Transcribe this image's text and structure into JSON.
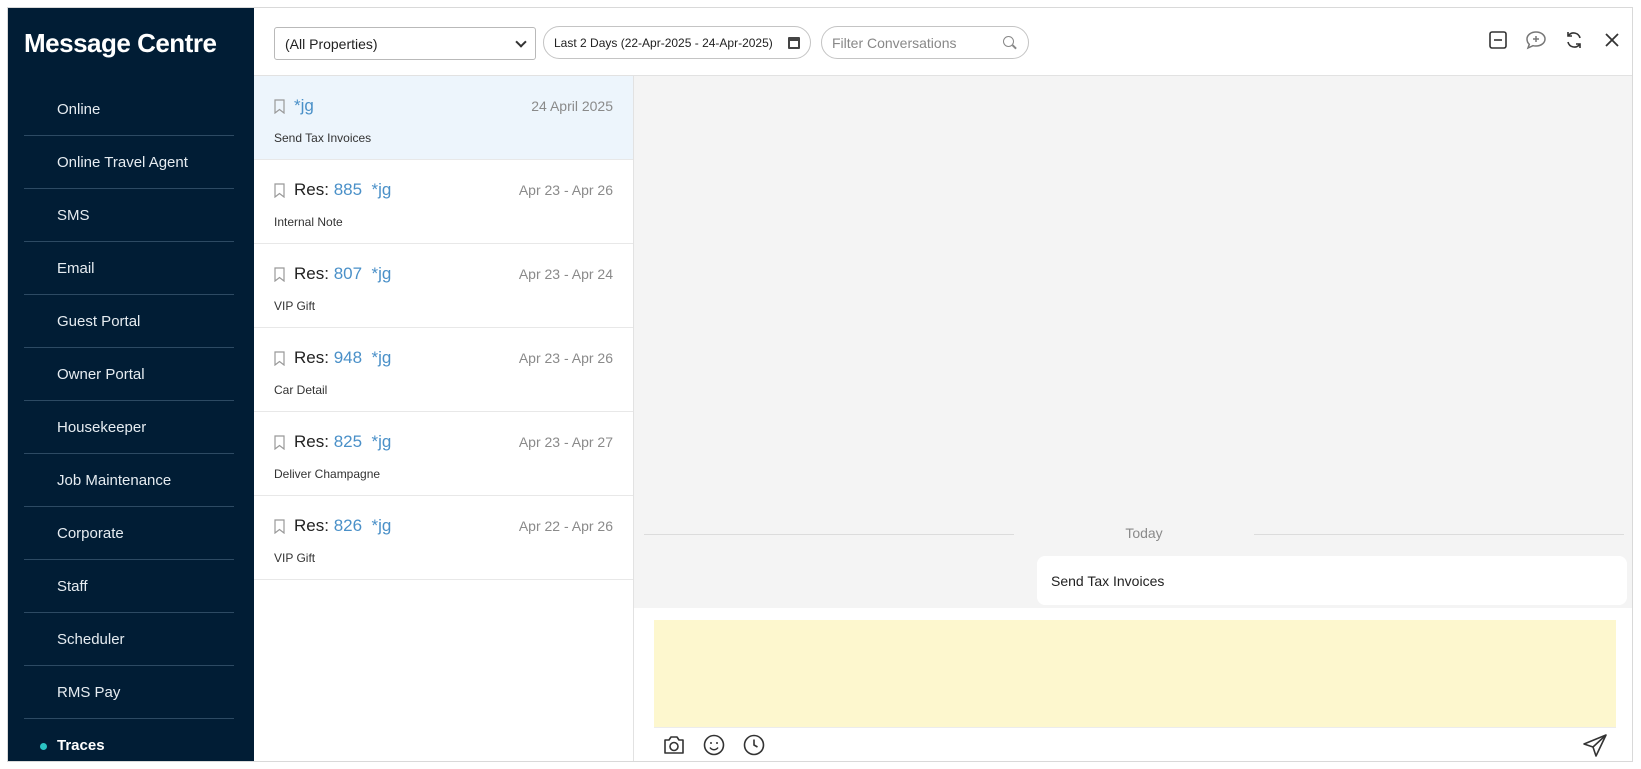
{
  "app_title": "Message Centre",
  "sidebar": {
    "items": [
      {
        "label": "Online"
      },
      {
        "label": "Online Travel Agent"
      },
      {
        "label": "SMS"
      },
      {
        "label": "Email"
      },
      {
        "label": "Guest Portal"
      },
      {
        "label": "Owner Portal"
      },
      {
        "label": "Housekeeper"
      },
      {
        "label": "Job Maintenance"
      },
      {
        "label": "Corporate"
      },
      {
        "label": "Staff"
      },
      {
        "label": "Scheduler"
      },
      {
        "label": "RMS Pay"
      },
      {
        "label": "Traces",
        "active": true
      }
    ],
    "active_dot_color": "#2bc3c3",
    "background": "#011d35"
  },
  "toolbar": {
    "property_select": "(All Properties)",
    "date_range": "Last 2 Days (22-Apr-2025 - 24-Apr-2025)",
    "filter_placeholder": "Filter Conversations",
    "icons": [
      "minimize-icon",
      "new-message-icon",
      "refresh-icon",
      "close-icon"
    ]
  },
  "conversations": [
    {
      "res_prefix": "",
      "res_no": "",
      "tag": "*jg",
      "dates": "24 April 2025",
      "subject": "Send Tax Invoices",
      "selected": true
    },
    {
      "res_prefix": "Res:",
      "res_no": "885",
      "tag": "*jg",
      "dates": "Apr 23 - Apr 26",
      "subject": "Internal Note"
    },
    {
      "res_prefix": "Res:",
      "res_no": "807",
      "tag": "*jg",
      "dates": "Apr 23 - Apr 24",
      "subject": "VIP Gift"
    },
    {
      "res_prefix": "Res:",
      "res_no": "948",
      "tag": "*jg",
      "dates": "Apr 23 - Apr 26",
      "subject": "Car Detail"
    },
    {
      "res_prefix": "Res:",
      "res_no": "825",
      "tag": "*jg",
      "dates": "Apr 23 - Apr 27",
      "subject": "Deliver Champagne"
    },
    {
      "res_prefix": "Res:",
      "res_no": "826",
      "tag": "*jg",
      "dates": "Apr 22 - Apr 26",
      "subject": "VIP Gift"
    }
  ],
  "chat": {
    "day_label": "Today",
    "messages": [
      {
        "text": "Send Tax Invoices"
      }
    ]
  },
  "composer": {
    "value": "",
    "background": "#fdf7ce",
    "icons": [
      "camera-icon",
      "emoji-icon",
      "clock-icon",
      "send-icon"
    ]
  },
  "colors": {
    "link_blue": "#4a90c8",
    "selected_row": "#edf5fc"
  }
}
